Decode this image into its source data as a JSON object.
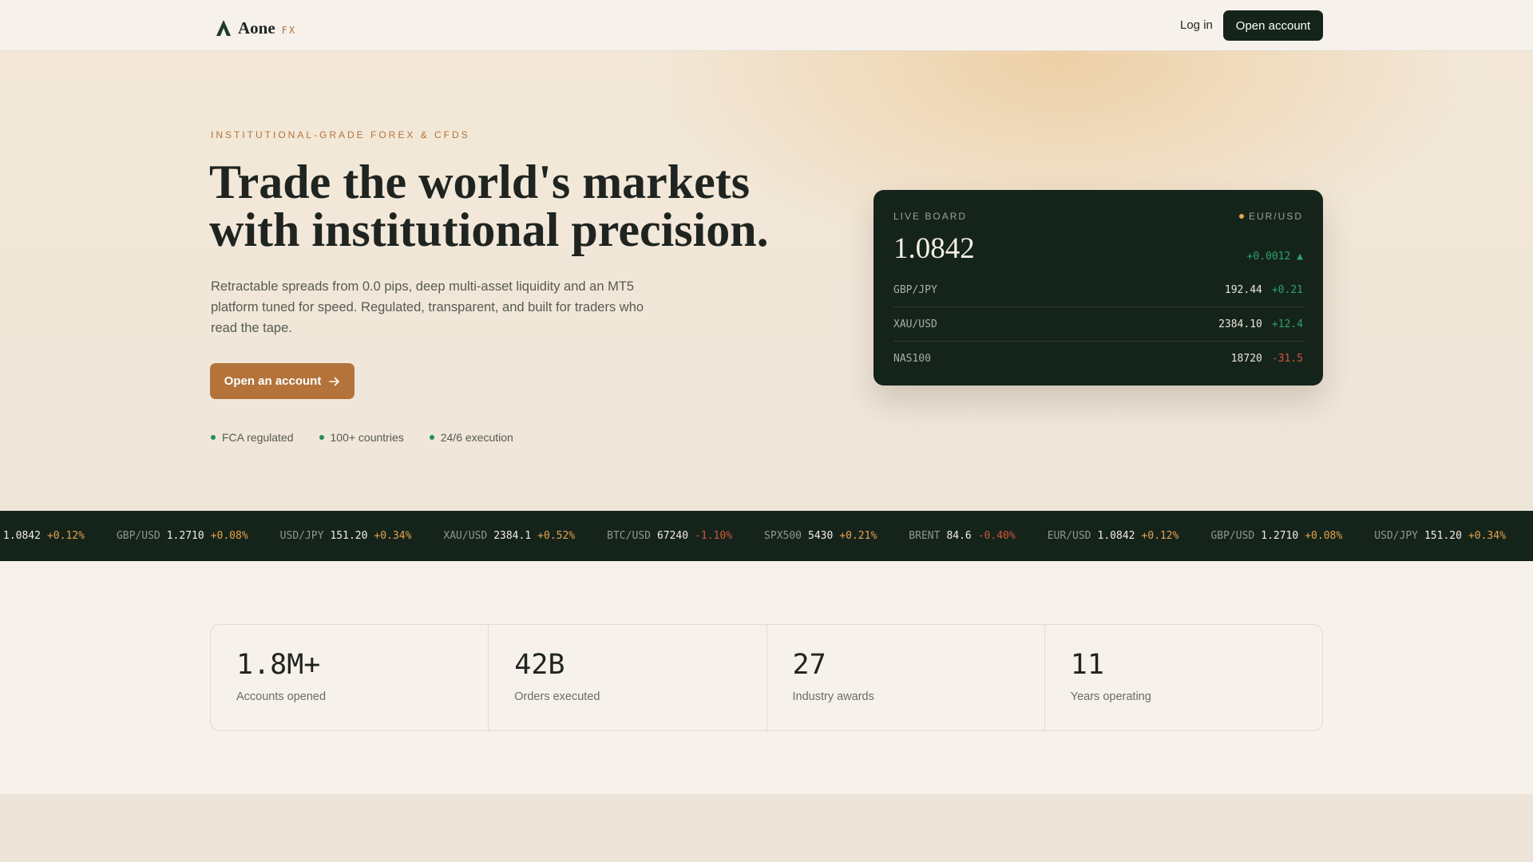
{
  "nav": {
    "brand_name": "Aone",
    "brand_suffix": "FX",
    "login_label": "Log in",
    "open_account_label": "Open account"
  },
  "hero": {
    "eyebrow": "INSTITUTIONAL-GRADE FOREX & CFDS",
    "headline_line1": "Trade the world's markets",
    "headline_line2": "with institutional precision.",
    "subtext": "Retractable spreads from 0.0 pips, deep multi-asset liquidity and an MT5 platform tuned for speed. Regulated, transparent, and built for traders who read the tape.",
    "cta_label": "Open an account",
    "trust": [
      "FCA regulated",
      "100+ countries",
      "24/6 execution"
    ]
  },
  "board": {
    "label": "LIVE BOARD",
    "pair": "EUR/USD",
    "price": "1.0842",
    "change": "+0.0012 ▲",
    "rows": [
      {
        "symbol": "GBP/JPY",
        "value": "192.44",
        "change": "+0.21",
        "direction": "up"
      },
      {
        "symbol": "XAU/USD",
        "value": "2384.10",
        "change": "+12.4",
        "direction": "up"
      },
      {
        "symbol": "NAS100",
        "value": "18720",
        "change": "-31.5",
        "direction": "down"
      }
    ]
  },
  "ticker": [
    {
      "symbol": "",
      "value": "1.0842",
      "change": "+0.12%",
      "direction": "up"
    },
    {
      "symbol": "GBP/USD",
      "value": "1.2710",
      "change": "+0.08%",
      "direction": "up"
    },
    {
      "symbol": "USD/JPY",
      "value": "151.20",
      "change": "+0.34%",
      "direction": "up"
    },
    {
      "symbol": "XAU/USD",
      "value": "2384.1",
      "change": "+0.52%",
      "direction": "up"
    },
    {
      "symbol": "BTC/USD",
      "value": "67240",
      "change": "-1.10%",
      "direction": "down"
    },
    {
      "symbol": "SPX500",
      "value": "5430",
      "change": "+0.21%",
      "direction": "up"
    },
    {
      "symbol": "BRENT",
      "value": "84.6",
      "change": "-0.40%",
      "direction": "down"
    },
    {
      "symbol": "EUR/USD",
      "value": "1.0842",
      "change": "+0.12%",
      "direction": "up"
    },
    {
      "symbol": "GBP/USD",
      "value": "1.2710",
      "change": "+0.08%",
      "direction": "up"
    },
    {
      "symbol": "USD/JPY",
      "value": "151.20",
      "change": "+0.34%",
      "direction": "up"
    }
  ],
  "stats": [
    {
      "value": "1.8M+",
      "label": "Accounts opened"
    },
    {
      "value": "42B",
      "label": "Orders executed"
    },
    {
      "value": "27",
      "label": "Industry awards"
    },
    {
      "value": "11",
      "label": "Years operating"
    }
  ],
  "colors": {
    "accent": "#b3733a",
    "dark": "#15241b",
    "positive": "#2ea26a",
    "negative": "#d2543a",
    "ticker_positive": "#e6a24b"
  }
}
